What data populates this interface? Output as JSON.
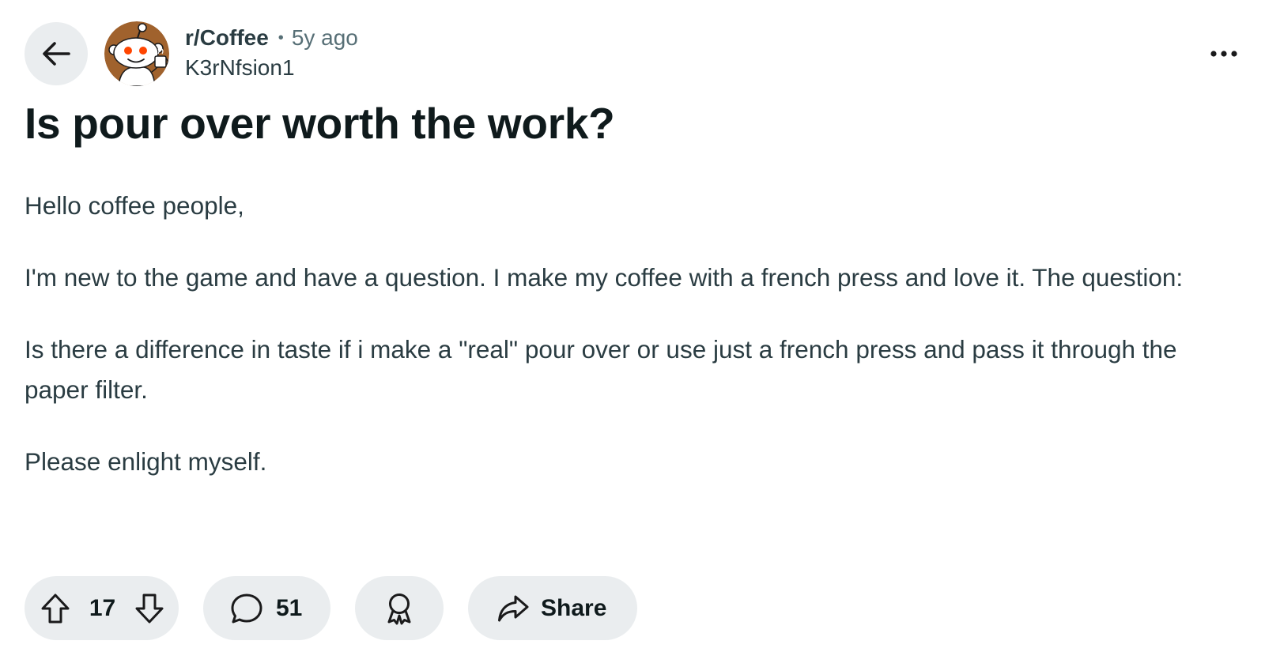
{
  "header": {
    "subreddit": "r/Coffee",
    "separator": "•",
    "age": "5y ago",
    "author": "K3rNfsion1"
  },
  "post": {
    "title": "Is pour over worth the work?",
    "body": [
      "Hello coffee people,",
      "I'm new to the game and have a question. I make my coffee with a french press and love it. The question:",
      "Is there a difference in taste if i make a \"real\" pour over or use just a french press and pass it through the paper filter.",
      "Please enlight myself."
    ]
  },
  "actions": {
    "votes": "17",
    "comments": "51",
    "share_label": "Share"
  },
  "icons": {
    "back": "arrow-left-icon",
    "more": "ellipsis-icon",
    "upvote": "arrow-up-icon",
    "downvote": "arrow-down-icon",
    "comment": "speech-bubble-icon",
    "award": "award-ribbon-icon",
    "share": "share-arrow-icon"
  },
  "colors": {
    "pill_background": "#eaedef",
    "avatar_background": "#a0622d",
    "avatar_eyes": "#ff4500",
    "text_primary": "#0f1a1c",
    "text_secondary": "#576f76"
  }
}
